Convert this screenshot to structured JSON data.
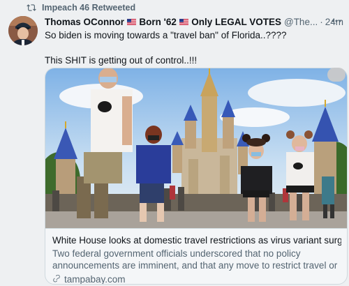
{
  "retweet": {
    "label": "Impeach 46 Retweeted",
    "icon": "retweet-icon"
  },
  "author": {
    "name": "Thomas OConnor",
    "name_part2": "Born '62",
    "name_part3": "Only LEGAL VOTES",
    "handle": "@The...",
    "separator": "·",
    "time": "24m",
    "avatar_icon": "avatar-portrait"
  },
  "tweet": {
    "line1": "So biden is moving towards a \"travel ban\" of Florida..????",
    "line2": "This SHIT is getting out of control..!!!"
  },
  "card": {
    "image_alt": "Visitors at theme park castle",
    "title": "White House looks at domestic travel restrictions as virus variant surges...",
    "description": "Two federal government officials underscored that no policy announcements are imminent, and that any move to restrict travel or ...",
    "domain": "tampabay.com"
  },
  "colors": {
    "background": "#eef0f2",
    "text_primary": "#0f1419",
    "text_secondary": "#536471",
    "border": "#cfd9de"
  }
}
